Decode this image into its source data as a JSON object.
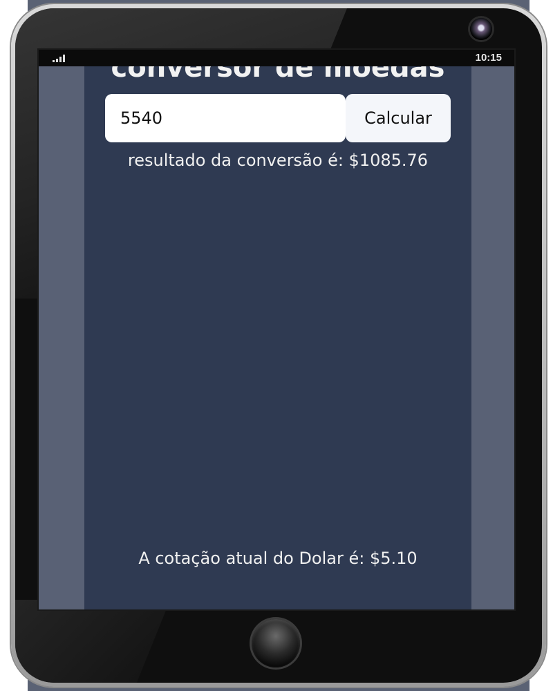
{
  "status_bar": {
    "time": "10:15"
  },
  "app": {
    "title": "conversor de moedas",
    "amount_input": {
      "value": "5540"
    },
    "calculate_label": "Calcular",
    "result_text": "resultado da conversão é: $1085.76",
    "rate_text": "A cotação atual do Dolar é: $5.10"
  },
  "colors": {
    "app_background": "#2f3a52",
    "page_background": "#596175",
    "input_background": "#ffffff",
    "text": "#f0f0f0"
  },
  "icons": [
    "signal-icon",
    "camera-icon",
    "home-button-icon"
  ]
}
